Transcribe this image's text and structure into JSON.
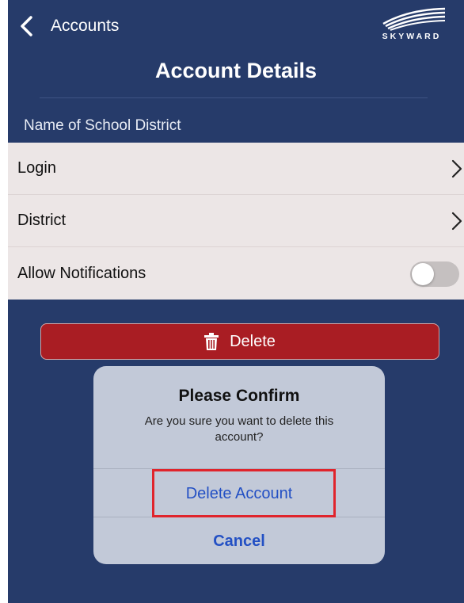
{
  "header": {
    "back_label": "Accounts",
    "title": "Account Details",
    "logo_text": "SKYWARD"
  },
  "section": {
    "label": "Name of School District"
  },
  "settings": [
    {
      "label": "Login",
      "control": "chevron-right-icon"
    },
    {
      "label": "District",
      "control": "chevron-right-icon"
    },
    {
      "label": "Allow Notifications",
      "control": "toggle",
      "enabled": false
    }
  ],
  "delete_button": {
    "label": "Delete",
    "icon": "trash-icon"
  },
  "dialog": {
    "title": "Please Confirm",
    "message": "Are you sure you want to delete this account?",
    "confirm_label": "Delete Account",
    "cancel_label": "Cancel"
  },
  "colors": {
    "background": "#263b6a",
    "list_background": "#ece6e6",
    "danger": "#a91d23",
    "dialog_background": "#c2c9d8",
    "dialog_button": "#2350c4",
    "highlight": "#e0242c"
  }
}
